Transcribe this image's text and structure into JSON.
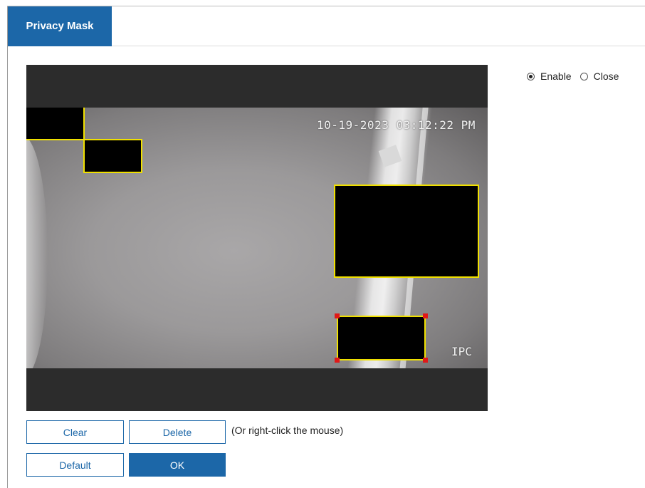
{
  "tab": {
    "title": "Privacy Mask"
  },
  "video": {
    "timestamp": "10-19-2023 03:12:22 PM",
    "device_label": "IPC",
    "mask_border_color": "#f0e000",
    "selected_handle_color": "#e01818"
  },
  "mode": {
    "options": [
      {
        "label": "Enable",
        "selected": true
      },
      {
        "label": "Close",
        "selected": false
      }
    ]
  },
  "buttons": {
    "clear": "Clear",
    "delete": "Delete",
    "default": "Default",
    "ok": "OK"
  },
  "hint": "(Or right-click the mouse)",
  "colors": {
    "accent": "#1c67a8"
  }
}
